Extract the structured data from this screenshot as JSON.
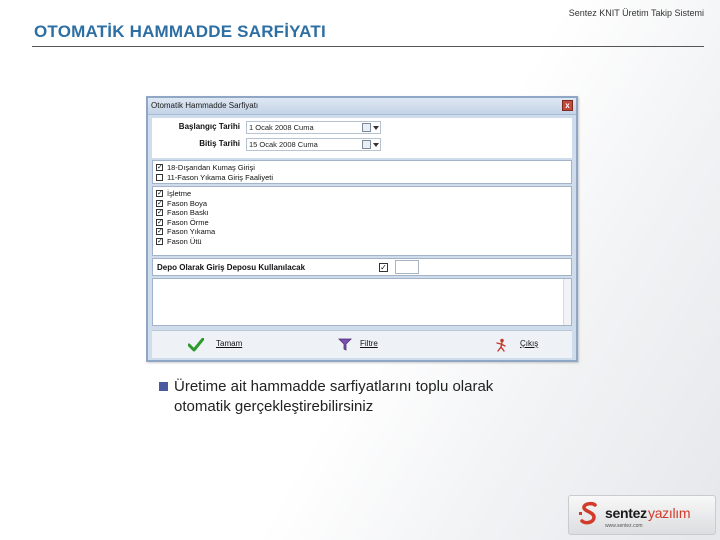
{
  "slide": {
    "title": "OTOMATİK HAMMADDE SARFİYATI",
    "system_name": "Sentez KNIT Üretim Takip Sistemi"
  },
  "dialog": {
    "title": "Otomatik Hammadde Sarfiyatı",
    "close_label": "x",
    "start_label": "Başlangıç Tarihi",
    "start_value": "1 Ocak 2008 Cuma",
    "end_label": "Bitiş Tarihi",
    "end_value": "15 Ocak 2008 Cuma",
    "group1": [
      {
        "label": "18-Dışarıdan Kumaş Girişi",
        "checked": true
      },
      {
        "label": "11-Fason Yıkama Giriş Faaliyeti",
        "checked": false
      }
    ],
    "group2": [
      {
        "label": "İşletme",
        "checked": true
      },
      {
        "label": "Fason Boya",
        "checked": true
      },
      {
        "label": "Fason Baskı",
        "checked": true
      },
      {
        "label": "Fason Örme",
        "checked": true
      },
      {
        "label": "Fason Yıkama",
        "checked": true
      },
      {
        "label": "Fason Ütü",
        "checked": true
      }
    ],
    "depot_label": "Depo Olarak Giriş Deposu Kullanılacak",
    "depot_checked": true,
    "buttons": {
      "ok_label": "Tamam",
      "filter_label": "Filtre",
      "exit_label": "Çıkış"
    }
  },
  "bullet": {
    "text": "Üretime ait hammadde sarfiyatlarını toplu olarak otomatik gerçekleştirebilirsiniz"
  },
  "logo": {
    "word1": "sentez",
    "word2": "yazılım",
    "url": "www.sentez.com"
  },
  "colors": {
    "title": "#2e6fa3",
    "bullet": "#4a5aa0",
    "logo_accent": "#d23a2a"
  }
}
